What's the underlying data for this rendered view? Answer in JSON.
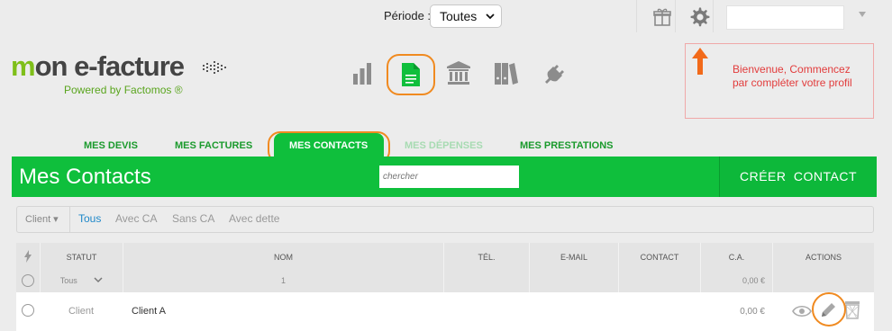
{
  "topbar": {
    "periode_label": "Période :",
    "periode_value": "Toutes",
    "icons": [
      "gift-icon",
      "gear-icon"
    ],
    "user_value": ""
  },
  "logo": {
    "prefix": "m",
    "main": "on e-facture",
    "subtitle": "Powered by Factomos ®"
  },
  "modules": [
    "bar-chart-icon",
    "document-icon",
    "bank-icon",
    "binders-icon",
    "plug-icon"
  ],
  "welcome": {
    "text": "Bienvenue, Commencez par compléter votre profil"
  },
  "tabs": [
    {
      "label": "MES DEVIS",
      "state": "normal"
    },
    {
      "label": "MES FACTURES",
      "state": "normal"
    },
    {
      "label": "MES CONTACTS",
      "state": "active"
    },
    {
      "label": "MES DÉPENSES",
      "state": "disabled"
    },
    {
      "label": "MES PRESTATIONS",
      "state": "normal"
    }
  ],
  "header": {
    "title": "Mes Contacts",
    "search_placeholder": "chercher",
    "create_label": "CRÉER CONTACT"
  },
  "filters": {
    "client_dropdown": "Client ▾",
    "chips": [
      {
        "label": "Tous",
        "active": true
      },
      {
        "label": "Avec CA",
        "active": false
      },
      {
        "label": "Sans CA",
        "active": false
      },
      {
        "label": "Avec dette",
        "active": false
      }
    ]
  },
  "table": {
    "columns": [
      "STATUT",
      "NOM",
      "TÉL.",
      "E-MAIL",
      "CONTACT",
      "C.A.",
      "ACTIONS"
    ],
    "filter_row": {
      "statut": "Tous",
      "nom": "1",
      "ca": "0,00 €"
    },
    "rows": [
      {
        "statut": "Client",
        "nom": "Client A",
        "tel": "",
        "email": "",
        "contact": "",
        "ca": "0,00 €"
      }
    ]
  },
  "colors": {
    "brand_green": "#0fbf3c",
    "highlight_orange": "#f08a20",
    "welcome_red": "#e23c3c",
    "link_blue": "#1e88c9"
  }
}
